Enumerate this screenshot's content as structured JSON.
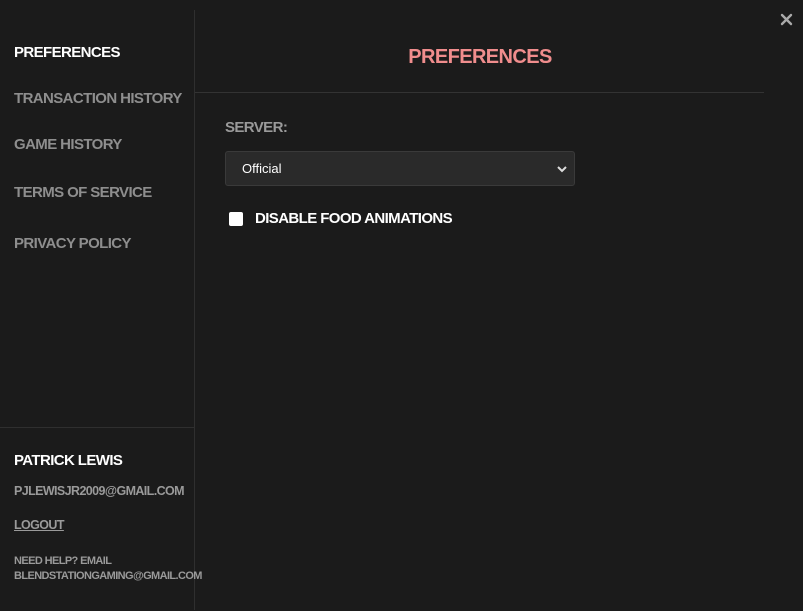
{
  "sidebar": {
    "items": [
      {
        "label": "PREFERENCES",
        "active": true
      },
      {
        "label": "TRANSACTION HISTORY",
        "active": false
      },
      {
        "label": "GAME HISTORY",
        "active": false
      },
      {
        "label": "TERMS OF SERVICE",
        "active": false
      },
      {
        "label": "PRIVACY POLICY",
        "active": false
      }
    ]
  },
  "user": {
    "name": "PATRICK LEWIS",
    "email": "PJLEWISJR2009@GMAIL.COM",
    "logout_label": "LOGOUT",
    "help_line1": "NEED HELP? EMAIL",
    "help_line2": "BLENDSTATIONGAMING@GMAIL.COM"
  },
  "main": {
    "title": "PREFERENCES",
    "server_label": "SERVER:",
    "server_value": "Official",
    "checkbox_label": "DISABLE FOOD ANIMATIONS",
    "checkbox_checked": false
  },
  "colors": {
    "background": "#1b1b1b",
    "accent": "#f08d8d",
    "muted_text": "#8e8e8e"
  },
  "icons": {
    "close": "close-icon",
    "select": "chevron-down-icon"
  }
}
